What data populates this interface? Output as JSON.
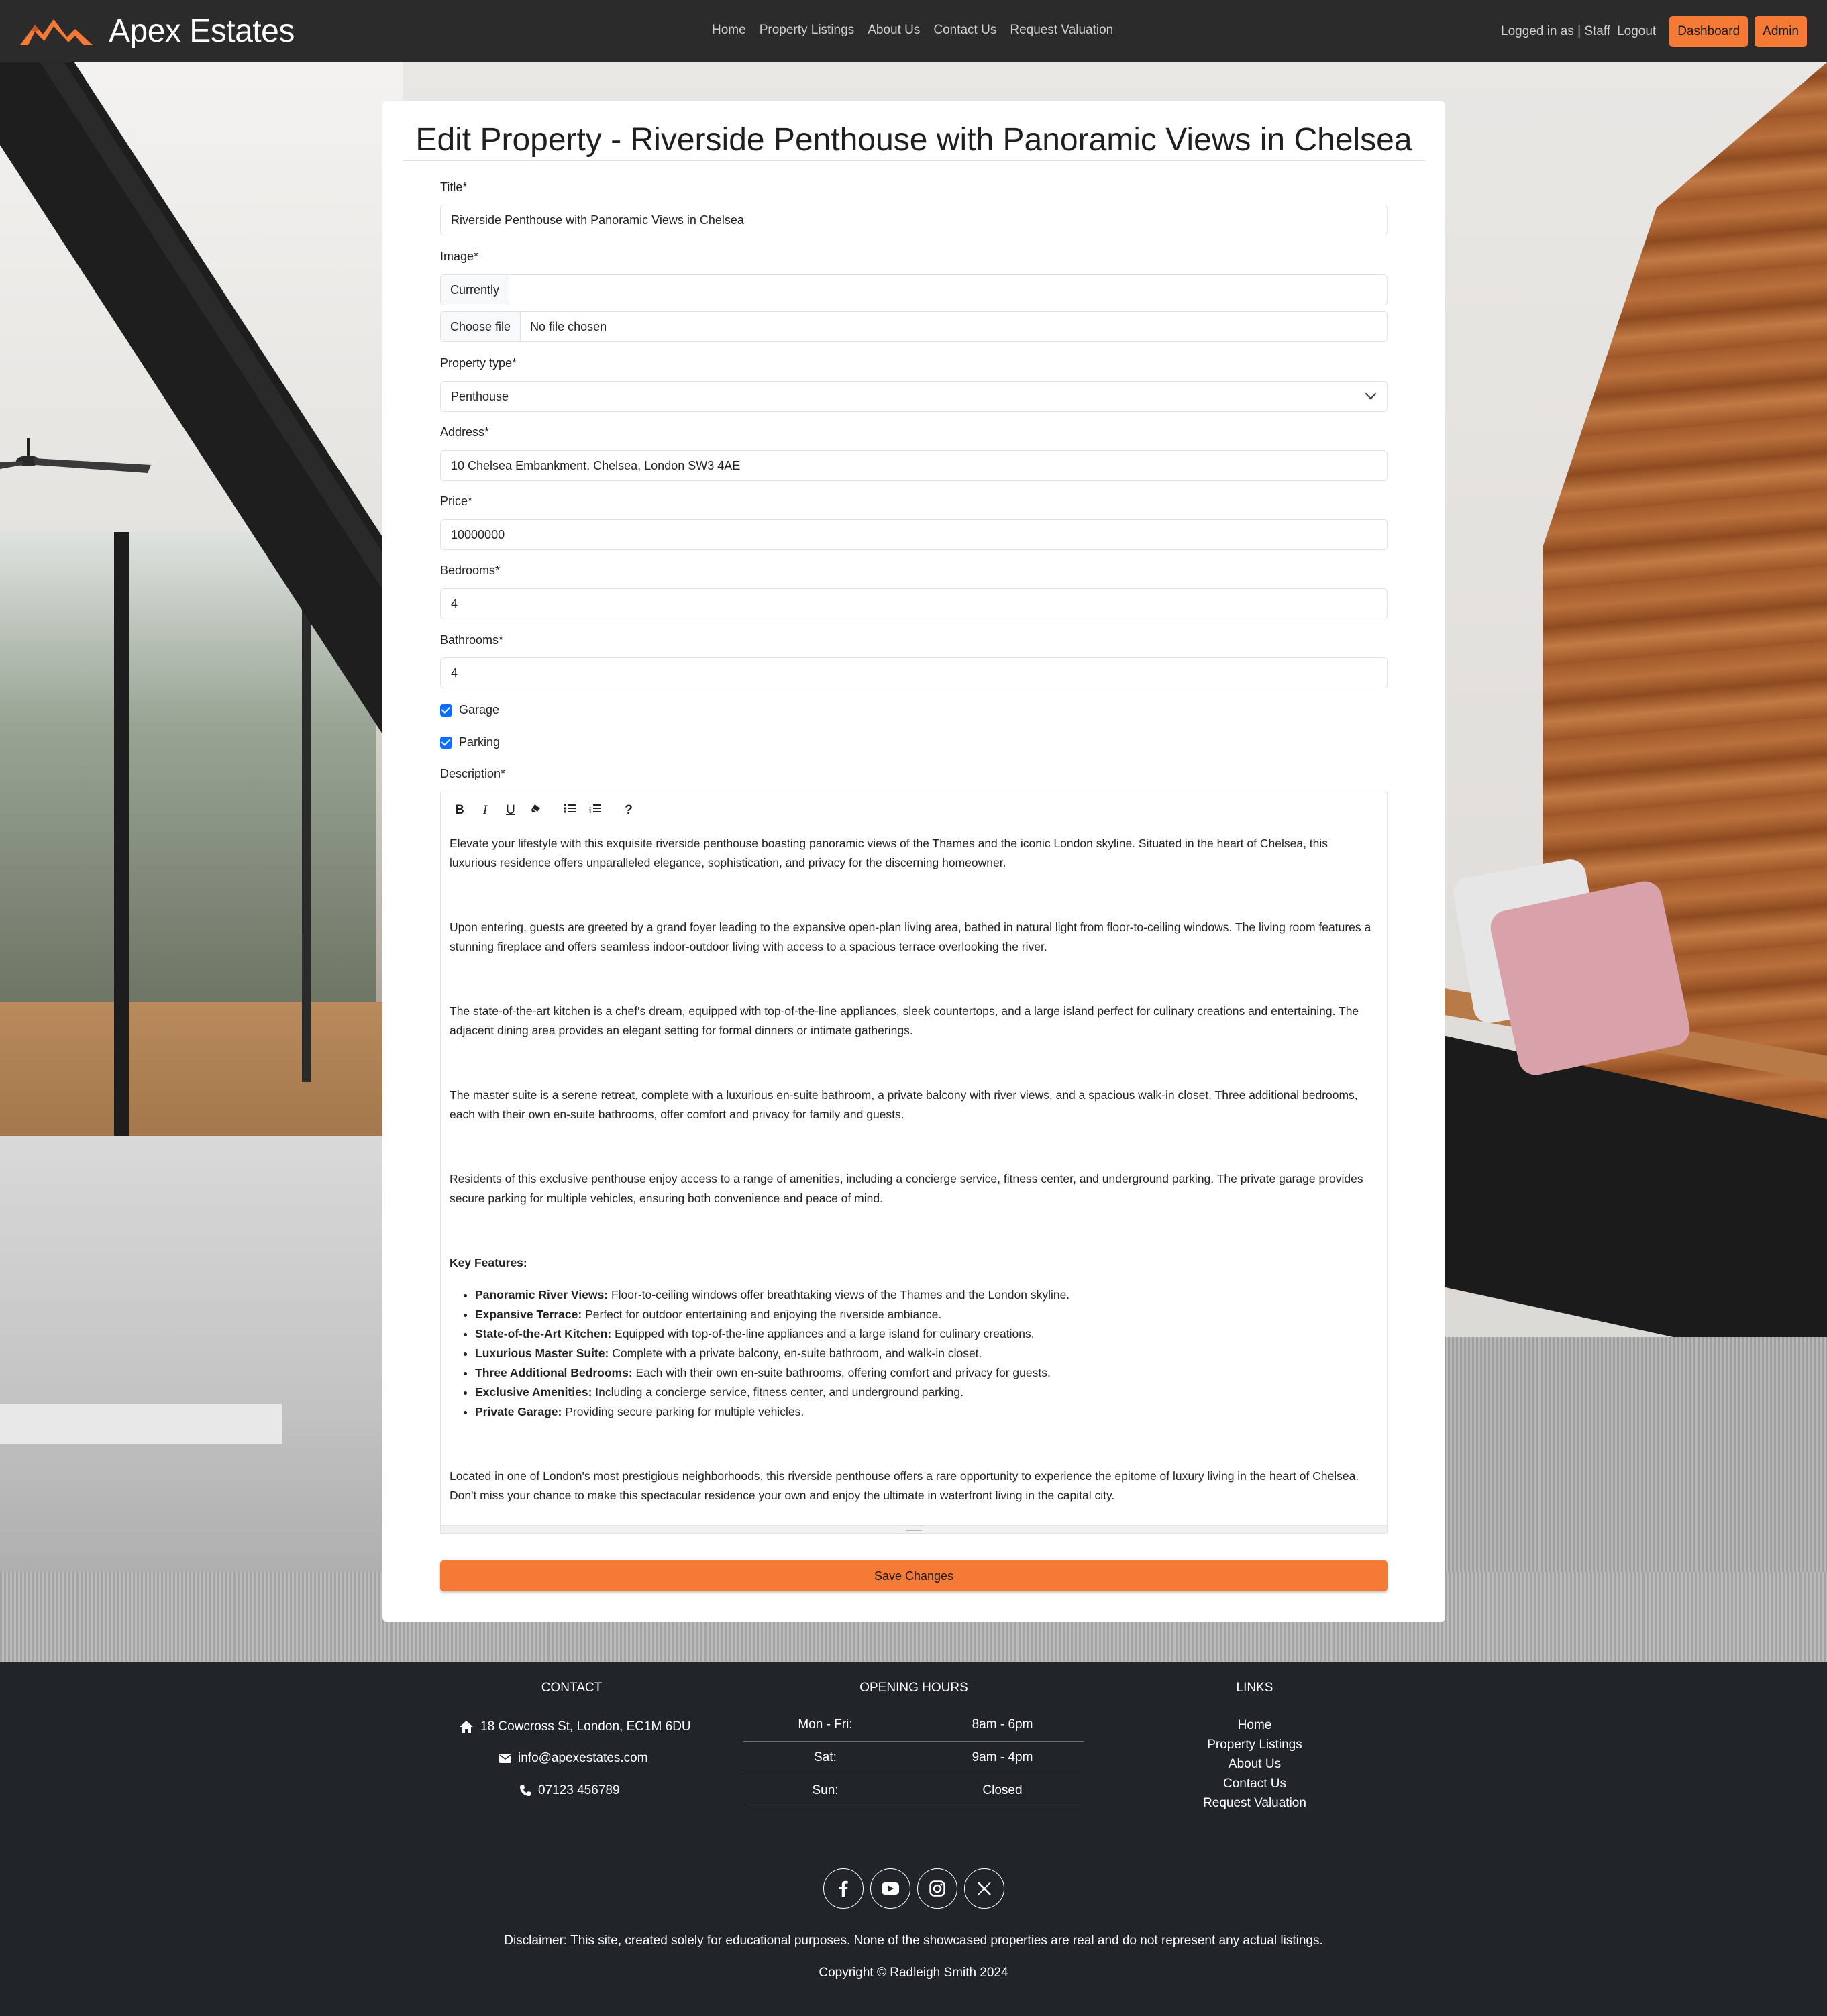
{
  "navbar": {
    "brand": "Apex Estates",
    "links": [
      "Home",
      "Property Listings",
      "About Us",
      "Contact Us",
      "Request Valuation"
    ],
    "logged_in": "Logged in as | Staff",
    "logout": "Logout",
    "dashboard": "Dashboard",
    "admin": "Admin"
  },
  "form": {
    "heading": "Edit Property - Riverside Penthouse with Panoramic Views in Chelsea",
    "title_label": "Title*",
    "title_value": "Riverside Penthouse with Panoramic Views in Chelsea",
    "image_label": "Image*",
    "image_currently": "Currently",
    "image_choose": "Choose file",
    "image_nofile": "No file chosen",
    "property_type_label": "Property type*",
    "property_type_value": "Penthouse",
    "address_label": "Address*",
    "address_value": "10 Chelsea Embankment, Chelsea, London SW3 4AE",
    "price_label": "Price*",
    "price_value": "10000000",
    "bedrooms_label": "Bedrooms*",
    "bedrooms_value": "4",
    "bathrooms_label": "Bathrooms*",
    "bathrooms_value": "4",
    "garage_label": "Garage",
    "garage_checked": true,
    "parking_label": "Parking",
    "parking_checked": true,
    "description_label": "Description*",
    "save_label": "Save Changes"
  },
  "editor": {
    "toolbar": [
      "B",
      "I",
      "U",
      "eraser-icon",
      "unordered-list-icon",
      "ordered-list-icon",
      "?"
    ],
    "paragraphs": [
      "Elevate your lifestyle with this exquisite riverside penthouse boasting panoramic views of the Thames and the iconic London skyline. Situated in the heart of Chelsea, this luxurious residence offers unparalleled elegance, sophistication, and privacy for the discerning homeowner.",
      "Upon entering, guests are greeted by a grand foyer leading to the expansive open-plan living area, bathed in natural light from floor-to-ceiling windows. The living room features a stunning fireplace and offers seamless indoor-outdoor living with access to a spacious terrace overlooking the river.",
      "The state-of-the-art kitchen is a chef's dream, equipped with top-of-the-line appliances, sleek countertops, and a large island perfect for culinary creations and entertaining. The adjacent dining area provides an elegant setting for formal dinners or intimate gatherings.",
      "The master suite is a serene retreat, complete with a luxurious en-suite bathroom, a private balcony with river views, and a spacious walk-in closet. Three additional bedrooms, each with their own en-suite bathrooms, offer comfort and privacy for family and guests.",
      "Residents of this exclusive penthouse enjoy access to a range of amenities, including a concierge service, fitness center, and underground parking. The private garage provides secure parking for multiple vehicles, ensuring both convenience and peace of mind."
    ],
    "features_heading": "Key Features:",
    "features": [
      {
        "name": "Panoramic River Views:",
        "text": " Floor-to-ceiling windows offer breathtaking views of the Thames and the London skyline."
      },
      {
        "name": "Expansive Terrace:",
        "text": " Perfect for outdoor entertaining and enjoying the riverside ambiance."
      },
      {
        "name": "State-of-the-Art Kitchen:",
        "text": " Equipped with top-of-the-line appliances and a large island for culinary creations."
      },
      {
        "name": "Luxurious Master Suite:",
        "text": " Complete with a private balcony, en-suite bathroom, and walk-in closet."
      },
      {
        "name": "Three Additional Bedrooms:",
        "text": " Each with their own en-suite bathrooms, offering comfort and privacy for guests."
      },
      {
        "name": "Exclusive Amenities:",
        "text": " Including a concierge service, fitness center, and underground parking."
      },
      {
        "name": "Private Garage:",
        "text": " Providing secure parking for multiple vehicles."
      }
    ],
    "closing": "Located in one of London's most prestigious neighborhoods, this riverside penthouse offers a rare opportunity to experience the epitome of luxury living in the heart of Chelsea. Don't miss your chance to make this spectacular residence your own and enjoy the ultimate in waterfront living in the capital city."
  },
  "footer": {
    "contact_heading": "CONTACT",
    "address": "18 Cowcross St, London, EC1M 6DU",
    "email": "info@apexestates.com",
    "phone": "07123 456789",
    "hours_heading": "OPENING HOURS",
    "hours": [
      {
        "day": "Mon - Fri:",
        "time": "8am - 6pm"
      },
      {
        "day": "Sat:",
        "time": "9am - 4pm"
      },
      {
        "day": "Sun:",
        "time": "Closed"
      }
    ],
    "links_heading": "LINKS",
    "links": [
      "Home",
      "Property Listings",
      "About Us",
      "Contact Us",
      "Request Valuation"
    ],
    "social": [
      "facebook-icon",
      "youtube-icon",
      "instagram-icon",
      "x-icon"
    ],
    "disclaimer": "Disclaimer: This site, created solely for educational purposes. None of the showcased properties are real and do not represent any actual listings.",
    "copyright": "Copyright © Radleigh Smith 2024"
  },
  "colors": {
    "accent": "#f57a36",
    "navbar": "#2b2b2b",
    "footer": "#212529",
    "checkbox": "#0d6efd"
  }
}
